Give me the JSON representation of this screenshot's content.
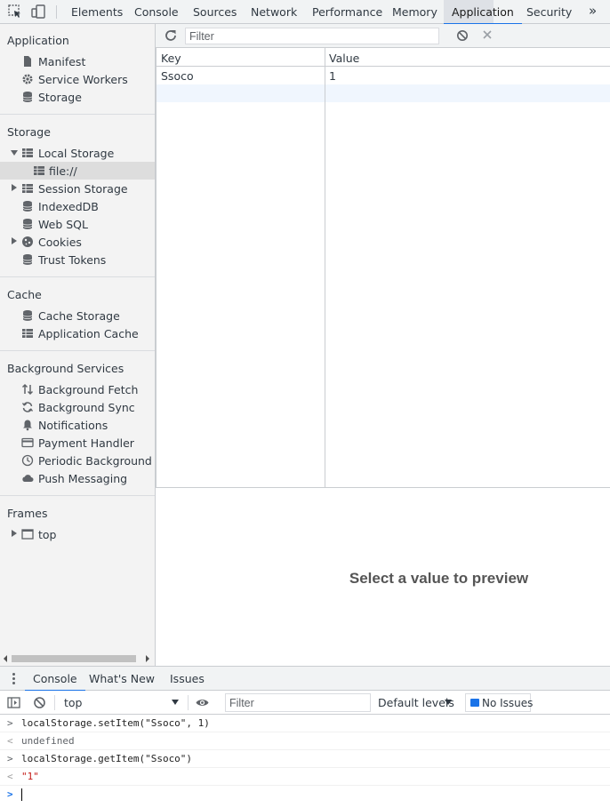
{
  "tabs": [
    "Elements",
    "Console",
    "Sources",
    "Network",
    "Performance",
    "Memory",
    "Application",
    "Security"
  ],
  "active_tab": "Application",
  "more_glyph": "»",
  "sidebar": {
    "application": {
      "title": "Application",
      "items": [
        {
          "label": "Manifest",
          "icon": "document-icon"
        },
        {
          "label": "Service Workers",
          "icon": "gear-icon"
        },
        {
          "label": "Storage",
          "icon": "database-icon"
        }
      ]
    },
    "storage": {
      "title": "Storage",
      "items": [
        {
          "label": "Local Storage",
          "icon": "table-icon"
        },
        {
          "label": "file://",
          "icon": "table-icon"
        },
        {
          "label": "Session Storage",
          "icon": "table-icon"
        },
        {
          "label": "IndexedDB",
          "icon": "database-icon"
        },
        {
          "label": "Web SQL",
          "icon": "database-icon"
        },
        {
          "label": "Cookies",
          "icon": "cookie-icon"
        },
        {
          "label": "Trust Tokens",
          "icon": "database-icon"
        }
      ]
    },
    "cache": {
      "title": "Cache",
      "items": [
        {
          "label": "Cache Storage",
          "icon": "database-icon"
        },
        {
          "label": "Application Cache",
          "icon": "table-icon"
        }
      ]
    },
    "background": {
      "title": "Background Services",
      "items": [
        {
          "label": "Background Fetch",
          "icon": "up-down-arrows-icon"
        },
        {
          "label": "Background Sync",
          "icon": "sync-icon"
        },
        {
          "label": "Notifications",
          "icon": "bell-icon"
        },
        {
          "label": "Payment Handler",
          "icon": "card-icon"
        },
        {
          "label": "Periodic Background Syn",
          "icon": "clock-icon"
        },
        {
          "label": "Push Messaging",
          "icon": "cloud-icon"
        }
      ]
    },
    "frames": {
      "title": "Frames",
      "items": [
        {
          "label": "top",
          "icon": "frame-icon"
        }
      ]
    }
  },
  "storage_view": {
    "filter_placeholder": "Filter",
    "columns": [
      "Key",
      "Value"
    ],
    "rows": [
      {
        "key": "Ssoco",
        "value": "1"
      }
    ],
    "preview_message": "Select a value to preview"
  },
  "drawer": {
    "tabs": [
      "Console",
      "What's New",
      "Issues"
    ],
    "active_tab": "Console",
    "context": "top",
    "filter_placeholder": "Filter",
    "levels": "Default levels",
    "issues_label": "No Issues"
  },
  "console_lines": [
    {
      "type": "input",
      "prefix": ">",
      "text": "localStorage.setItem(\"Ssoco\", 1)"
    },
    {
      "type": "result",
      "prefix": "<",
      "text": "undefined"
    },
    {
      "type": "input",
      "prefix": ">",
      "text": "localStorage.getItem(\"Ssoco\")"
    },
    {
      "type": "string",
      "prefix": "<",
      "text": "\"1\""
    }
  ],
  "prompt_glyph": ">",
  "colors": {
    "accent": "#1a73e8",
    "selected_row": "#f0f6fe",
    "string": "#c41a16"
  }
}
